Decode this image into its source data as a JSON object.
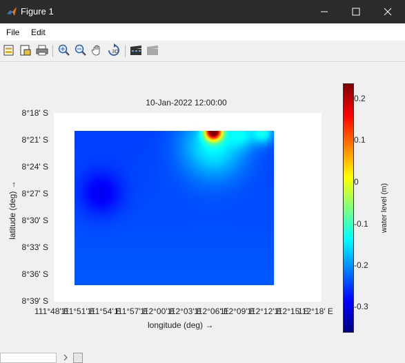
{
  "window": {
    "title": "Figure 1",
    "icons": {
      "app": "matlab-icon",
      "minimize": "minimize-icon",
      "maximize": "maximize-icon",
      "close": "close-icon"
    }
  },
  "menu": {
    "items": [
      "File",
      "Edit"
    ]
  },
  "toolbar": {
    "tools": [
      "new-figure-icon",
      "open-file-icon",
      "print-icon",
      "zoom-in-icon",
      "zoom-out-icon",
      "pan-icon",
      "rotate-icon",
      "movie-icon",
      "disabled-movie-icon"
    ]
  },
  "chart": {
    "title": "10-Jan-2022 12:00:00",
    "xlabel": "longitude (deg) →",
    "ylabel": "latitude (deg) →",
    "colorbar_label": "water level (m)",
    "x_ticks": [
      "111°48' E",
      "111°51' E",
      "111°54' E",
      "111°57' E",
      "112°00' E",
      "112°03' E",
      "112°06' E",
      "112°09' E",
      "112°12' E",
      "112°15' E",
      "112°18' E"
    ],
    "y_ticks": [
      "8°18' S",
      "8°21' S",
      "8°24' S",
      "8°27' S",
      "8°30' S",
      "8°33' S",
      "8°36' S",
      "8°39' S"
    ],
    "colorbar_ticks": [
      "0.2",
      "0.1",
      "0",
      "-0.1",
      "-0.2",
      "-0.3"
    ]
  },
  "chart_data": {
    "type": "heatmap",
    "title": "10-Jan-2022 12:00:00",
    "xlabel": "longitude (deg) →",
    "ylabel": "latitude (deg) →",
    "colorbar": {
      "label": "water level (m)",
      "range": [
        -0.36,
        0.23
      ],
      "colormap": "jet"
    },
    "xlim": [
      111.8,
      112.3
    ],
    "ylim": [
      -8.65,
      -8.3
    ],
    "grid": false,
    "data_extent": {
      "lon": [
        111.83,
        112.21
      ],
      "lat": [
        -8.62,
        -8.335
      ]
    },
    "background_level": -0.25,
    "features": [
      {
        "lon": 112.095,
        "lat": -8.335,
        "value": 0.22,
        "radius_deg": 0.016
      },
      {
        "lon": 112.095,
        "lat": -8.36,
        "value": -0.14,
        "radius_deg": 0.06
      },
      {
        "lon": 112.15,
        "lat": -8.34,
        "value": -0.18,
        "radius_deg": 0.025
      },
      {
        "lon": 112.19,
        "lat": -8.338,
        "value": -0.14,
        "radius_deg": 0.02
      },
      {
        "lon": 111.88,
        "lat": -8.45,
        "value": -0.3,
        "radius_deg": 0.04
      }
    ]
  }
}
